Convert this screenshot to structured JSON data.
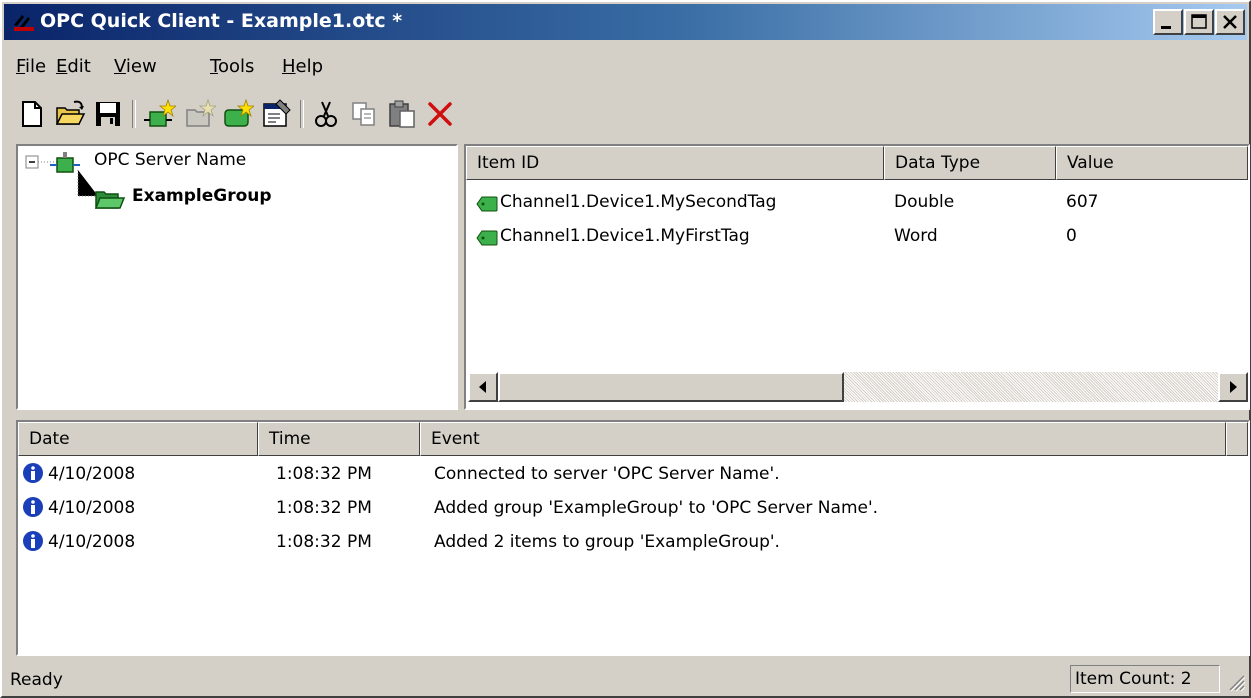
{
  "window": {
    "title": "OPC Quick Client - Example1.otc *",
    "minimize_icon": "minimize-icon",
    "maximize_icon": "maximize-icon",
    "close_icon": "close-icon"
  },
  "menu": {
    "items": [
      {
        "underline": "F",
        "rest": "ile"
      },
      {
        "underline": "E",
        "rest": "dit"
      },
      {
        "underline": "V",
        "rest": "iew"
      },
      {
        "underline": "T",
        "rest": "ools"
      },
      {
        "underline": "H",
        "rest": "elp"
      }
    ]
  },
  "toolbar": {
    "icons": [
      "new-file-icon",
      "open-folder-icon",
      "save-icon",
      "new-server-icon",
      "new-group-icon",
      "new-item-icon",
      "properties-icon",
      "cut-icon",
      "copy-icon",
      "paste-icon",
      "delete-icon"
    ]
  },
  "tree": {
    "server": "OPC Server Name",
    "group": "ExampleGroup"
  },
  "items_table": {
    "columns": [
      "Item ID",
      "Data Type",
      "Value"
    ],
    "rows": [
      {
        "item_id": "Channel1.Device1.MySecondTag",
        "data_type": "Double",
        "value": "607"
      },
      {
        "item_id": "Channel1.Device1.MyFirstTag",
        "data_type": "Word",
        "value": "0"
      }
    ]
  },
  "event_log": {
    "columns": [
      "Date",
      "Time",
      "Event"
    ],
    "rows": [
      {
        "date": "4/10/2008",
        "time": "1:08:32 PM",
        "event": "Connected to server 'OPC Server Name'."
      },
      {
        "date": "4/10/2008",
        "time": "1:08:32 PM",
        "event": "Added group 'ExampleGroup' to 'OPC Server Name'."
      },
      {
        "date": "4/10/2008",
        "time": "1:08:32 PM",
        "event": "Added 2 items to group 'ExampleGroup'."
      }
    ]
  },
  "status": {
    "text": "Ready",
    "item_count": "Item Count: 2"
  },
  "colors": {
    "titlebar_start": "#0a246a",
    "titlebar_end": "#a6caf0",
    "face": "#d4d0c8",
    "tag_green": "#3cb04a",
    "info_blue": "#1a3fb8",
    "delete_red": "#d01010"
  }
}
